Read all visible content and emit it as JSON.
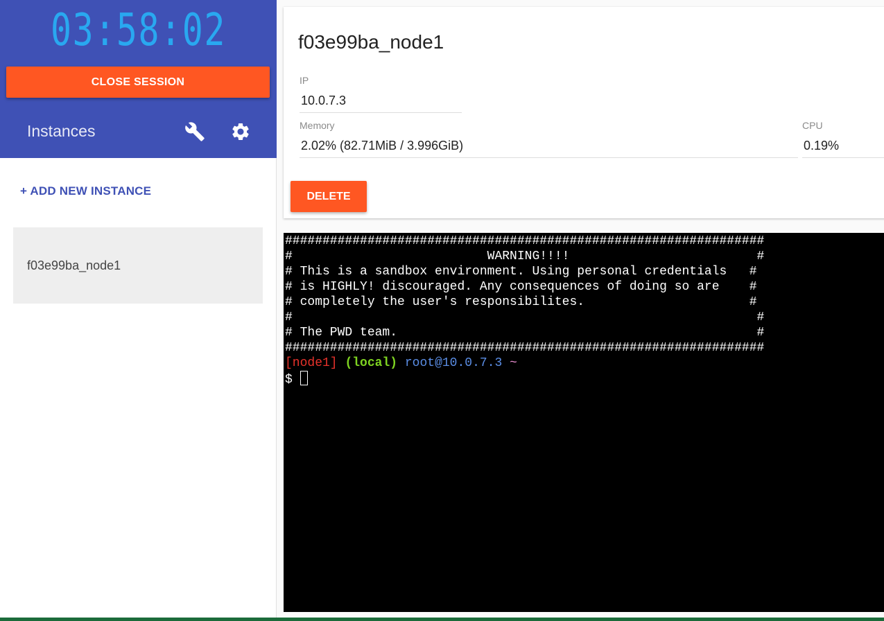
{
  "sidebar": {
    "timer": "03:58:02",
    "close_session_label": "CLOSE SESSION",
    "instances_title": "Instances",
    "add_instance_label": "+ ADD NEW INSTANCE",
    "instances": [
      {
        "name": "f03e99ba_node1"
      }
    ],
    "icons": {
      "settings_tool": "wrench-icon",
      "settings": "gear-icon"
    }
  },
  "instance": {
    "name": "f03e99ba_node1",
    "ip_label": "IP",
    "ip": "10.0.7.3",
    "memory_label": "Memory",
    "memory": "2.02% (82.71MiB / 3.996GiB)",
    "cpu_label": "CPU",
    "cpu": "0.19%",
    "delete_label": "DELETE"
  },
  "terminal": {
    "banner": [
      "################################################################",
      "#                          WARNING!!!!                         #",
      "# This is a sandbox environment. Using personal credentials   #",
      "# is HIGHLY! discouraged. Any consequences of doing so are    #",
      "# completely the user's responsibilites.                      #",
      "#                                                              #",
      "# The PWD team.                                                #",
      "################################################################"
    ],
    "prompt": {
      "node": "[node1]",
      "env": "(local)",
      "user_host": "root@10.0.7.3",
      "path": "~",
      "symbol": "$"
    }
  },
  "colors": {
    "primary": "#3f51b5",
    "accent": "#ff5722",
    "timer": "#29a8f0",
    "terminal_bg": "#000000"
  }
}
